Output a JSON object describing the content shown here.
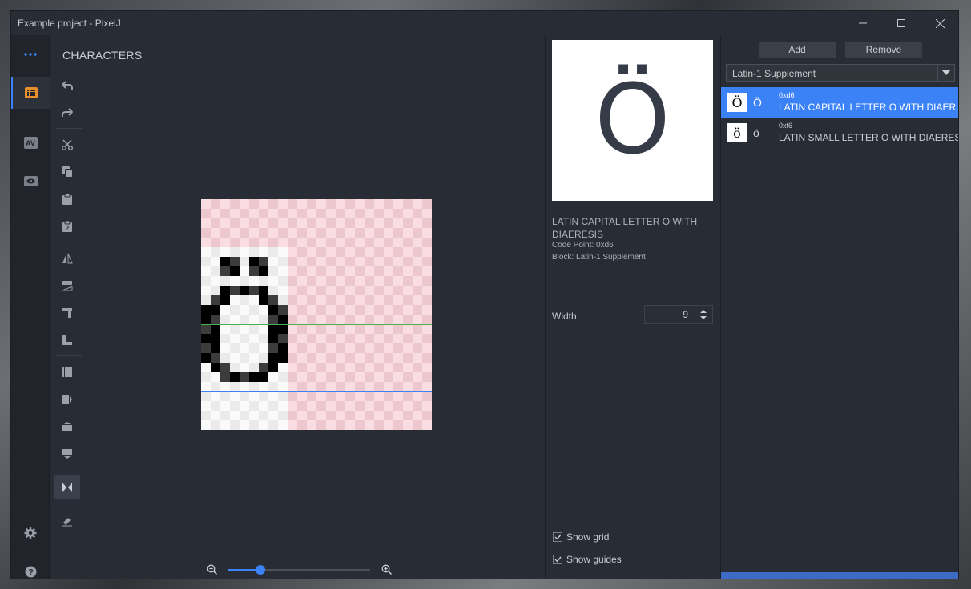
{
  "window": {
    "title": "Example project - PixelJ"
  },
  "nav": {
    "more_icon": "ellipsis-icon",
    "items": [
      {
        "icon": "characters-icon",
        "active": true
      },
      {
        "icon": "kerning-icon",
        "label": "AV"
      },
      {
        "icon": "preview-icon"
      }
    ],
    "settings_icon": "gear-icon",
    "help_icon": "help-icon"
  },
  "section": {
    "heading": "CHARACTERS"
  },
  "tools": [
    "undo-icon",
    "redo-icon",
    "cut-icon",
    "copy-icon",
    "paste-icon",
    "paste-special-icon",
    "flip-horizontal-icon",
    "flip-vertical-icon",
    "rotate-icon",
    "skew-icon",
    "shift-left-icon",
    "shift-right-icon",
    "shift-up-icon",
    "shift-down-icon",
    "symmetry-icon",
    "eraser-icon"
  ],
  "preview": {
    "char": "Ö",
    "name": "LATIN CAPITAL LETTER O WITH DIAERESIS",
    "code_point": "Code Point: 0xd6",
    "block": "Block: Latin-1 Supplement"
  },
  "width": {
    "label": "Width",
    "value": "9"
  },
  "options": {
    "show_grid": "Show grid",
    "show_guides": "Show guides"
  },
  "zoom": {
    "level": 0.23
  },
  "panel": {
    "add": "Add",
    "remove": "Remove",
    "block_select": "Latin-1 Supplement",
    "rows": [
      {
        "thumb": "Ö",
        "char": "Ö",
        "code": "0xd6",
        "name": "LATIN CAPITAL LETTER O WITH DIAER…",
        "selected": true
      },
      {
        "thumb": "ö",
        "char": "ö",
        "code": "0xf6",
        "name": "LATIN SMALL LETTER O WITH DIAERESIS",
        "selected": false
      }
    ]
  },
  "colors": {
    "accent": "#3b82f6",
    "bg": "#282c34",
    "guide_green": "#4caf50",
    "guide_blue": "#3b82f6"
  }
}
